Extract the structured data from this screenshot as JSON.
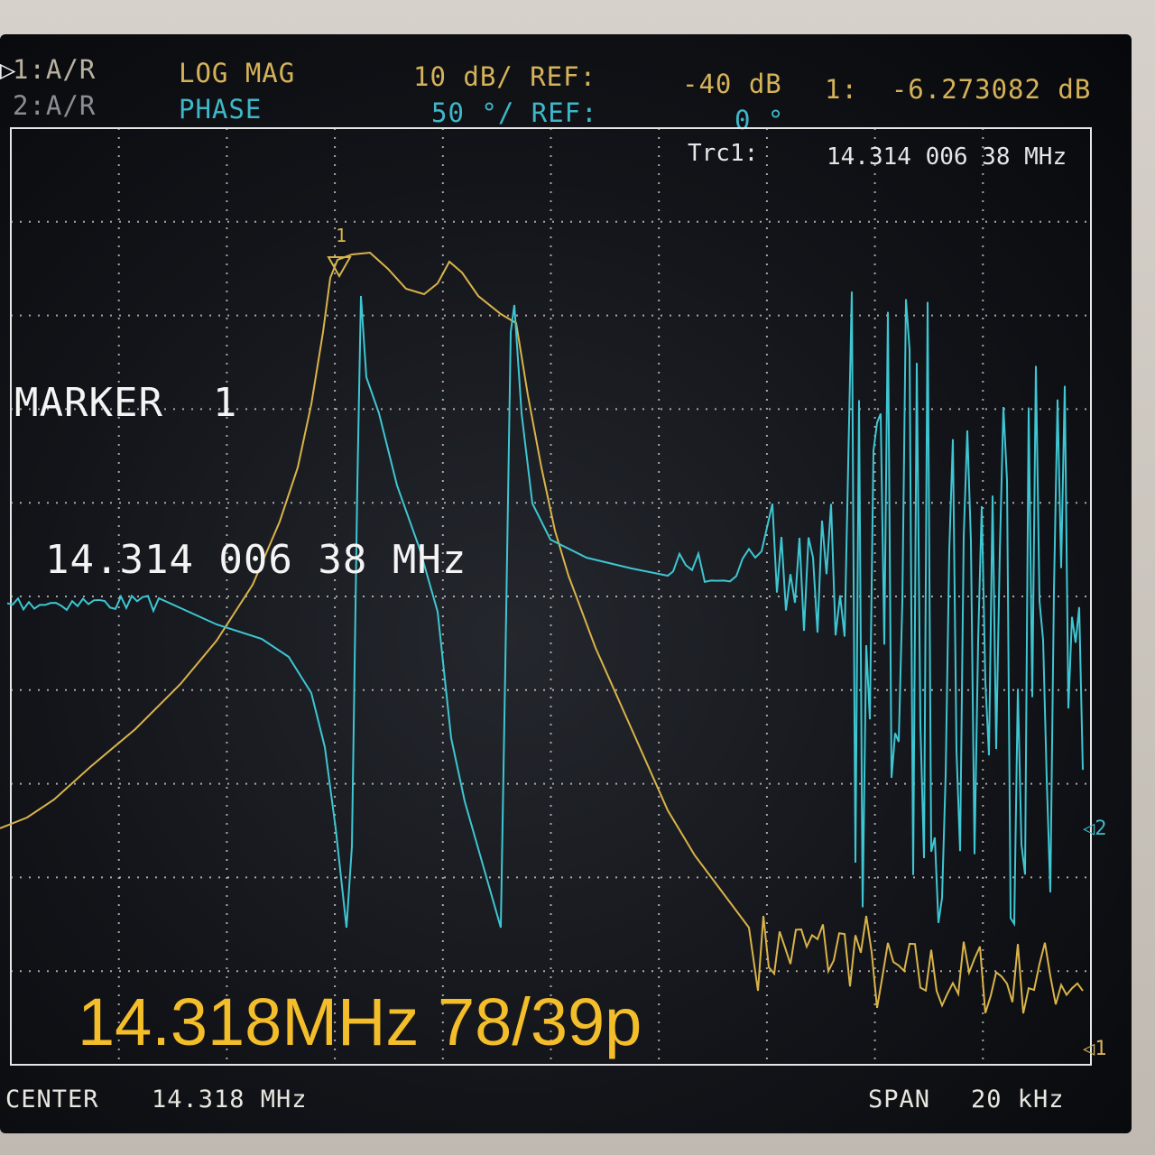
{
  "header": {
    "ch1_label": "1:A/R",
    "ch2_label": "2:A/R",
    "ch1_format": "LOG MAG",
    "ch2_format": "PHASE",
    "ch1_scale": "10 dB/ REF:",
    "ch2_scale": "50 °/ REF:",
    "ch1_ref": "-40 dB",
    "ch2_ref": "0 °",
    "marker_readout": "1:  -6.273082 dB"
  },
  "trace_info": {
    "label": "Trc1:",
    "value": "14.314 006 38 MHz"
  },
  "marker": {
    "title": "MARKER  1",
    "frequency": "14.314 006 38 MHz",
    "tick_label": "1"
  },
  "overlay": {
    "caption": "14.318MHz 78/39p"
  },
  "footer": {
    "center_label": "CENTER",
    "center_value": "14.318 MHz",
    "span_label": "SPAN",
    "span_value": "20 kHz"
  },
  "ref_marks": {
    "ch2": "2",
    "ch1": "1"
  },
  "colors": {
    "trace_logmag": "#d9b44a",
    "trace_phase": "#3ec6d2",
    "grid": "#d8d8d8"
  }
}
